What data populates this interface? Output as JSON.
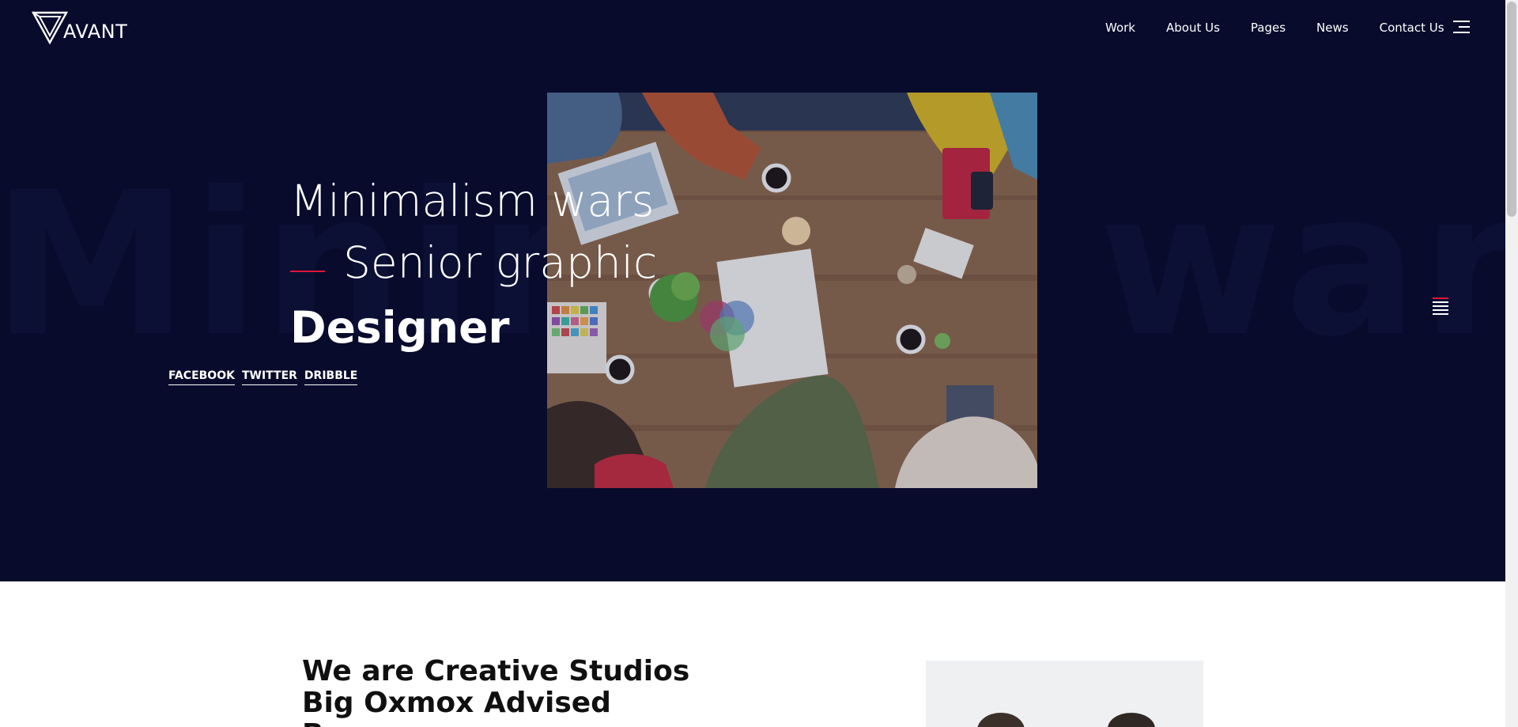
{
  "brand": {
    "name": "AVANT"
  },
  "nav": {
    "items": [
      {
        "label": "Work"
      },
      {
        "label": "About Us"
      },
      {
        "label": "Pages"
      },
      {
        "label": "News"
      },
      {
        "label": "Contact Us"
      }
    ],
    "menu_icon": "hamburger-icon"
  },
  "hero": {
    "background_words": {
      "left": "Minima",
      "right": "wars"
    },
    "headline": {
      "line1": "Minimalism wars",
      "line2": "Senior graphic",
      "line3": "Designer"
    },
    "socials": [
      {
        "label": "FACEBOOK"
      },
      {
        "label": "TWITTER"
      },
      {
        "label": "DRIBBLE"
      }
    ],
    "side_icon": "menu-lines-icon"
  },
  "about": {
    "title": "We are Creative Studios Big Oxmox Advised Because"
  },
  "colors": {
    "hero_bg": "#080b2c",
    "accent": "#e0153a",
    "text_light": "#ffffff",
    "text_dark": "#101010"
  }
}
